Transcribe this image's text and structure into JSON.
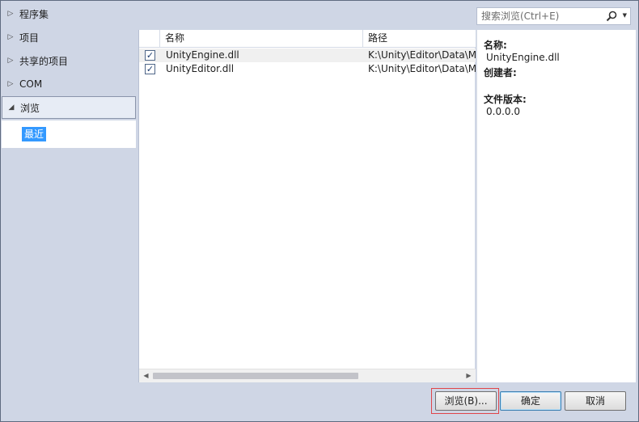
{
  "nav": {
    "items": [
      {
        "label": "程序集",
        "arrow": "▷"
      },
      {
        "label": "项目",
        "arrow": "▷"
      },
      {
        "label": "共享的项目",
        "arrow": "▷"
      },
      {
        "label": "COM",
        "arrow": "▷"
      },
      {
        "label": "浏览",
        "arrow": "◢"
      }
    ],
    "sub_item": "最近"
  },
  "search": {
    "placeholder": "搜索浏览(Ctrl+E)"
  },
  "list": {
    "columns": [
      "名称",
      "路径"
    ],
    "rows": [
      {
        "checked": true,
        "name": "UnityEngine.dll",
        "path": "K:\\Unity\\Editor\\Data\\M"
      },
      {
        "checked": true,
        "name": "UnityEditor.dll",
        "path": "K:\\Unity\\Editor\\Data\\M"
      }
    ]
  },
  "detail": {
    "name_label": "名称:",
    "name_value": "UnityEngine.dll",
    "creator_label": "创建者:",
    "version_label": "文件版本:",
    "version_value": "0.0.0.0"
  },
  "buttons": {
    "browse": "浏览(B)...",
    "ok": "确定",
    "cancel": "取消"
  },
  "colors": {
    "accent": "#3399ff",
    "highlight": "#e0454a"
  }
}
